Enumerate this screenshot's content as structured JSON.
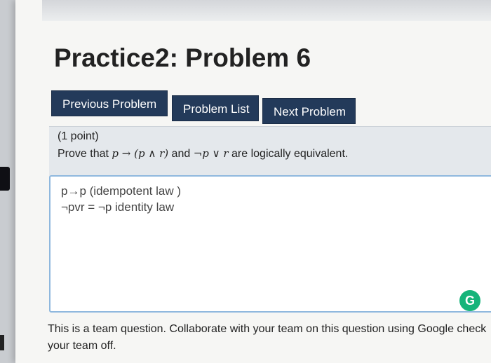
{
  "title": "Practice2: Problem 6",
  "nav": {
    "previous": "Previous Problem",
    "list": "Problem List",
    "next": "Next Problem"
  },
  "problem": {
    "points": "(1 point)",
    "prove_prefix": "Prove that",
    "expr1": "p → (p ∧ r)",
    "and_word": "and",
    "expr2": "¬p ∨ r",
    "suffix": "are logically equivalent."
  },
  "answer": {
    "line1": "p→p (idempotent law )",
    "line2": "¬pvr = ¬p identity law"
  },
  "grammar_icon": "G",
  "team_note": "This is a team question. Collaborate with your team on this question using Google check your team off.",
  "colors": {
    "button_bg": "#233a5a",
    "answer_border": "#8fb8de",
    "grammar_icon": "#15b47a"
  }
}
